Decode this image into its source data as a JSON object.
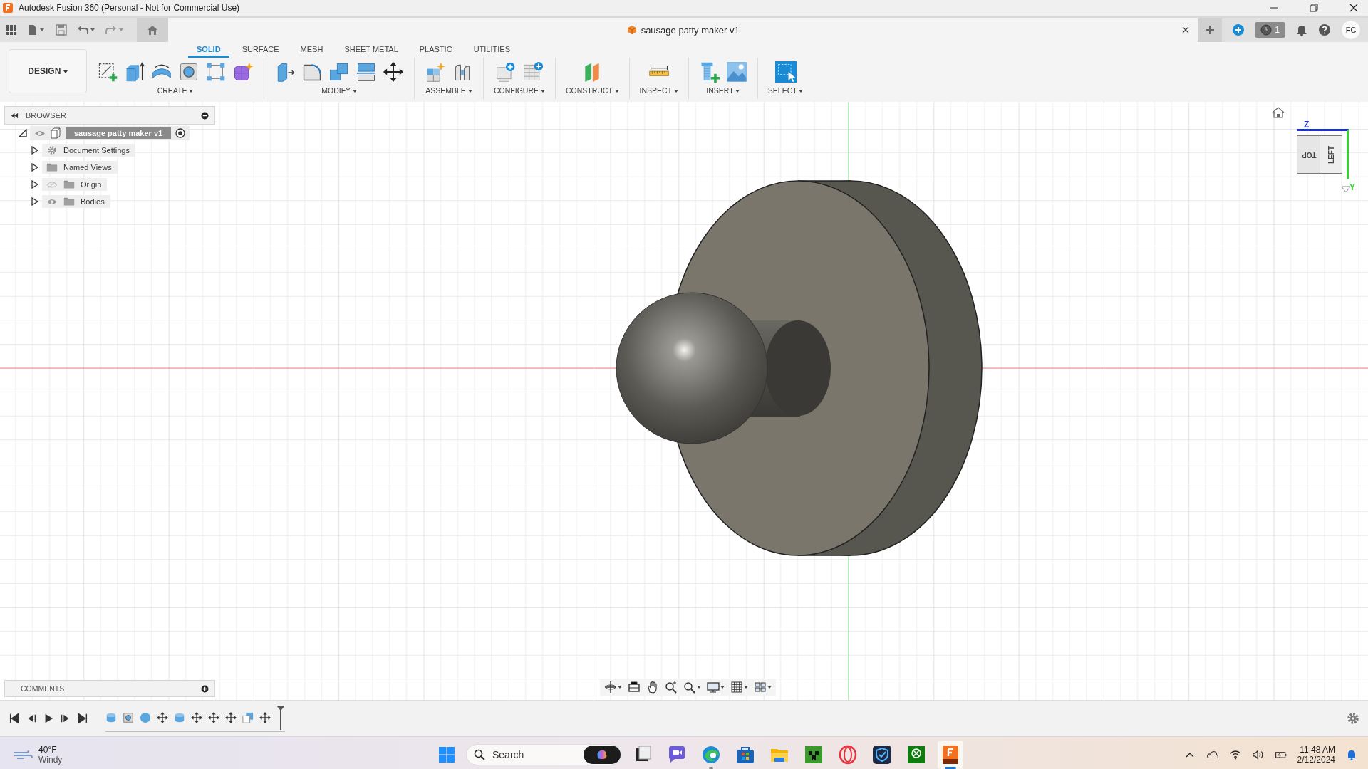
{
  "window": {
    "title": "Autodesk Fusion 360 (Personal - Not for Commercial Use)"
  },
  "document_tab": {
    "title": "sausage patty maker v1"
  },
  "header": {
    "job_count": "1",
    "avatar": "FC"
  },
  "workspace": {
    "label": "DESIGN"
  },
  "tabs": [
    {
      "label": "SOLID",
      "selected": true
    },
    {
      "label": "SURFACE",
      "selected": false
    },
    {
      "label": "MESH",
      "selected": false
    },
    {
      "label": "SHEET METAL",
      "selected": false
    },
    {
      "label": "PLASTIC",
      "selected": false
    },
    {
      "label": "UTILITIES",
      "selected": false
    }
  ],
  "tool_groups": [
    {
      "label": "CREATE"
    },
    {
      "label": "MODIFY"
    },
    {
      "label": "ASSEMBLE"
    },
    {
      "label": "CONFIGURE"
    },
    {
      "label": "CONSTRUCT"
    },
    {
      "label": "INSPECT"
    },
    {
      "label": "INSERT"
    },
    {
      "label": "SELECT"
    }
  ],
  "browser": {
    "title": "BROWSER",
    "root": {
      "label": "sausage patty maker v1",
      "visible": true,
      "children": [
        {
          "label": "Document Settings",
          "kind": "settings"
        },
        {
          "label": "Named Views",
          "kind": "folder"
        },
        {
          "label": "Origin",
          "kind": "folder",
          "visible": false
        },
        {
          "label": "Bodies",
          "kind": "folder",
          "visible": true
        }
      ]
    }
  },
  "view_cube": {
    "faces": [
      "TOP",
      "LEFT"
    ],
    "axes": [
      "Z",
      "Y"
    ]
  },
  "comments": {
    "title": "COMMENTS"
  },
  "taskbar": {
    "weather": {
      "temperature": "40°F",
      "condition": "Windy"
    },
    "search": {
      "placeholder": "Search"
    },
    "apps": [
      {
        "kind": "task-view",
        "running": false,
        "selected": false
      },
      {
        "kind": "chat",
        "running": false,
        "selected": false
      },
      {
        "kind": "browser",
        "running": true,
        "selected": false
      },
      {
        "kind": "store",
        "running": false,
        "selected": false
      },
      {
        "kind": "folder",
        "running": false,
        "selected": false
      },
      {
        "kind": "game",
        "running": false,
        "selected": false
      },
      {
        "kind": "ring",
        "running": false,
        "selected": false
      },
      {
        "kind": "shield",
        "running": false,
        "selected": false
      },
      {
        "kind": "xbox",
        "running": false,
        "selected": false
      },
      {
        "kind": "cad",
        "running": true,
        "selected": true
      }
    ],
    "time": "11:48 AM",
    "date": "2/12/2024"
  }
}
